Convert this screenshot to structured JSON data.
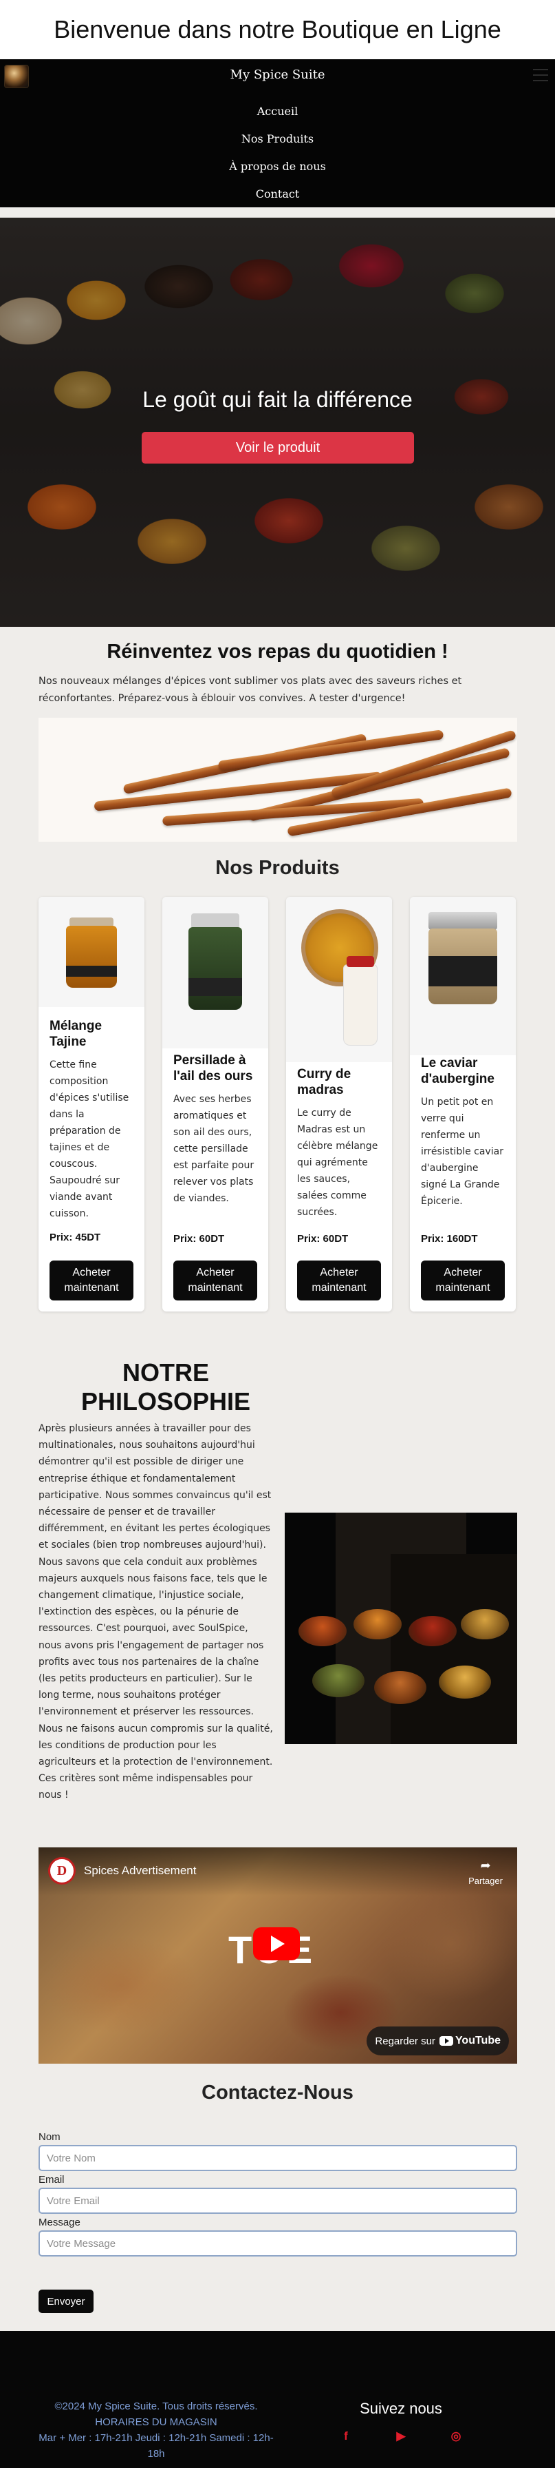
{
  "header": {
    "site_title": "Bienvenue dans notre Boutique en Ligne"
  },
  "nav": {
    "brand": "My Spice Suite",
    "links": [
      "Accueil",
      "Nos Produits",
      "À propos de nous",
      "Contact"
    ]
  },
  "hero": {
    "title": "Le goût qui fait la différence",
    "button_label": "Voir le produit",
    "button_color": "#dc3545"
  },
  "intro": {
    "title": "Réinventez vos repas du quotidien !",
    "text": "Nos nouveaux mélanges d'épices vont sublimer vos plats avec des saveurs riches et réconfortantes. Préparez-vous à éblouir vos convives. A tester d'urgence!"
  },
  "products": {
    "title": "Nos Produits",
    "items": [
      {
        "name": "Mélange Tajine",
        "description": "Cette fine composition d'épices s'utilise dans la préparation de tajines et de couscous. Saupoudré sur viande avant cuisson.",
        "price": "Prix: 45DT",
        "button_label": "Acheter maintenant"
      },
      {
        "name": "Persillade à l'ail des ours",
        "description": "Avec ses herbes aromatiques et son ail des ours, cette persillade est parfaite pour relever vos plats de viandes.",
        "price": "Prix: 60DT",
        "button_label": "Acheter maintenant"
      },
      {
        "name": "Curry de madras",
        "description": "Le curry de Madras est un célèbre mélange qui agrémente les sauces, salées comme sucrées.",
        "price": "Prix: 60DT",
        "button_label": "Acheter maintenant"
      },
      {
        "name": "Le caviar d'aubergine",
        "description": "Un petit pot en verre qui renferme un irrésistible caviar d'aubergine signé La Grande Épicerie.",
        "price": "Prix: 160DT",
        "button_label": "Acheter maintenant"
      }
    ]
  },
  "philosophy": {
    "title": "NOTRE PHILOSOPHIE",
    "text": "Après plusieurs années à travailler pour des multinationales, nous souhaitons aujourd'hui démontrer qu'il est possible de diriger une entreprise éthique et fondamentalement participative. Nous sommes convaincus qu'il est nécessaire de penser et de travailler différemment, en évitant les pertes écologiques et sociales (bien trop nombreuses aujourd'hui). Nous savons que cela conduit aux problèmes majeurs auxquels nous faisons face, tels que le changement climatique, l'injustice sociale, l'extinction des espèces, ou la pénurie de ressources. C'est pourquoi, avec SoulSpice, nous avons pris l'engagement de partager nos profits avec tous nos partenaires de la chaîne (les petits producteurs en particulier). Sur le long terme, nous souhaitons protéger l'environnement et préserver les ressources. Nous ne faisons aucun compromis sur la qualité, les conditions de production pour les agriculteurs et la protection de l'environnement. Ces critères sont même indispensables pour nous !"
  },
  "video": {
    "channel_initial": "D",
    "title": "Spices Advertisement",
    "share_label": "Partager",
    "overlay_text": "TOE",
    "watch_label": "Regarder sur",
    "youtube_label": "YouTube"
  },
  "contact": {
    "title": "Contactez-Nous",
    "fields": [
      {
        "label": "Nom",
        "placeholder": "Votre Nom"
      },
      {
        "label": "Email",
        "placeholder": "Votre Email"
      },
      {
        "label": "Message",
        "placeholder": "Votre Message"
      }
    ],
    "submit_label": "Envoyer"
  },
  "footer": {
    "copyright": "©2024 My Spice Suite. Tous droits réservés.",
    "hours_title": "HORAIRES DU MAGASIN",
    "hours": "Mar + Mer : 17h-21h Jeudi : 12h-21h Samedi : 12h-18h",
    "follow_title": "Suivez nous",
    "socials": [
      {
        "icon": "facebook-icon",
        "glyph": "f"
      },
      {
        "icon": "youtube-icon",
        "glyph": "▶"
      },
      {
        "icon": "instagram-icon",
        "glyph": "◎"
      }
    ],
    "link_color": "#7f9fd8",
    "social_color": "#e11d2b"
  }
}
